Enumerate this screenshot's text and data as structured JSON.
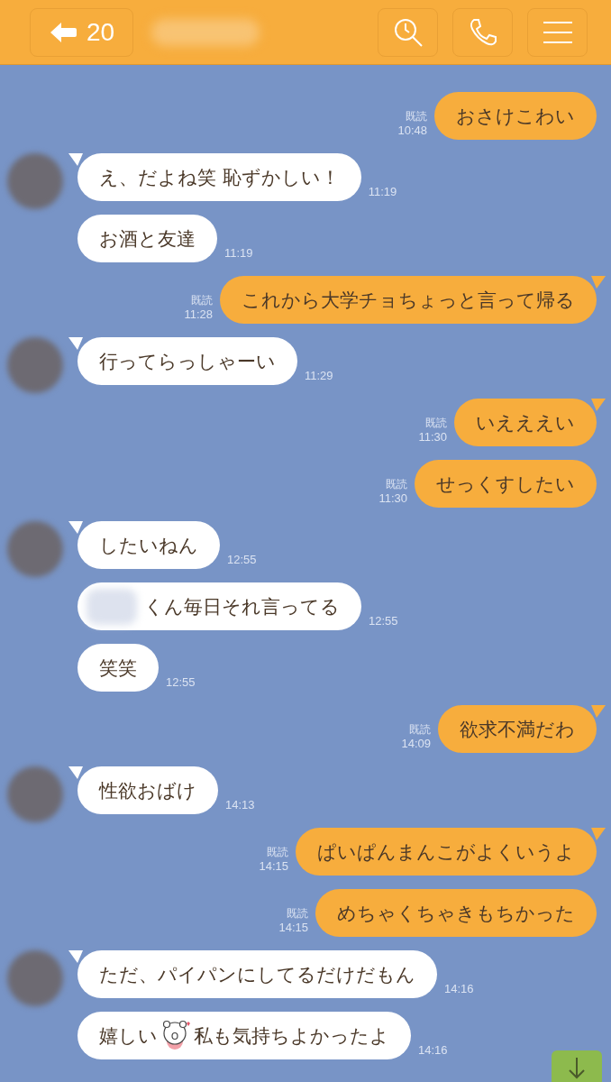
{
  "header": {
    "back_count": "20"
  },
  "messages": [
    {
      "kind": "out",
      "read_label": "既読",
      "time": "10:48",
      "avatar": false,
      "tail": false,
      "parts": [
        {
          "kind": "text",
          "text": "おさけこわい"
        }
      ]
    },
    {
      "kind": "in",
      "time": "11:19",
      "avatar": true,
      "tail": true,
      "parts": [
        {
          "kind": "text",
          "text": "え、だよね笑 恥ずかしい！"
        }
      ]
    },
    {
      "kind": "in",
      "time": "11:19",
      "avatar": false,
      "tail": false,
      "parts": [
        {
          "kind": "text",
          "text": "お酒と友達"
        }
      ]
    },
    {
      "kind": "out",
      "read_label": "既読",
      "time": "11:28",
      "avatar": false,
      "tail": true,
      "parts": [
        {
          "kind": "text",
          "text": "これから大学チョちょっと言って帰る"
        }
      ]
    },
    {
      "kind": "in",
      "time": "11:29",
      "avatar": true,
      "tail": true,
      "parts": [
        {
          "kind": "text",
          "text": "行ってらっしゃーい"
        }
      ]
    },
    {
      "kind": "out",
      "read_label": "既読",
      "time": "11:30",
      "avatar": false,
      "tail": true,
      "parts": [
        {
          "kind": "text",
          "text": "いえええい"
        }
      ]
    },
    {
      "kind": "out",
      "read_label": "既読",
      "time": "11:30",
      "avatar": false,
      "tail": false,
      "parts": [
        {
          "kind": "text",
          "text": "せっくすしたい"
        }
      ]
    },
    {
      "kind": "in",
      "time": "12:55",
      "avatar": true,
      "tail": true,
      "parts": [
        {
          "kind": "text",
          "text": "したいねん"
        }
      ]
    },
    {
      "kind": "in",
      "time": "12:55",
      "avatar": false,
      "tail": false,
      "parts": [
        {
          "kind": "redacted"
        },
        {
          "kind": "text",
          "text": "くん毎日それ言ってる"
        }
      ]
    },
    {
      "kind": "in",
      "time": "12:55",
      "avatar": false,
      "tail": false,
      "parts": [
        {
          "kind": "text",
          "text": "笑笑"
        }
      ]
    },
    {
      "kind": "out",
      "read_label": "既読",
      "time": "14:09",
      "avatar": false,
      "tail": true,
      "parts": [
        {
          "kind": "text",
          "text": "欲求不満だわ"
        }
      ]
    },
    {
      "kind": "in",
      "time": "14:13",
      "avatar": true,
      "tail": true,
      "parts": [
        {
          "kind": "text",
          "text": "性欲おばけ"
        }
      ]
    },
    {
      "kind": "out",
      "read_label": "既読",
      "time": "14:15",
      "avatar": false,
      "tail": true,
      "parts": [
        {
          "kind": "text",
          "text": "ぱいぱんまんこがよくいうよ"
        }
      ]
    },
    {
      "kind": "out",
      "read_label": "既読",
      "time": "14:15",
      "avatar": false,
      "tail": false,
      "parts": [
        {
          "kind": "text",
          "text": "めちゃくちゃきもちかった"
        }
      ]
    },
    {
      "kind": "in",
      "time": "14:16",
      "avatar": true,
      "tail": true,
      "parts": [
        {
          "kind": "text",
          "text": "ただ、パイパンにしてるだけだもん"
        }
      ]
    },
    {
      "kind": "in",
      "time": "14:16",
      "avatar": false,
      "tail": false,
      "parts": [
        {
          "kind": "text",
          "text": "嬉しい"
        },
        {
          "kind": "emoji"
        },
        {
          "kind": "text",
          "text": "私も気持ちよかったよ"
        }
      ]
    }
  ]
}
